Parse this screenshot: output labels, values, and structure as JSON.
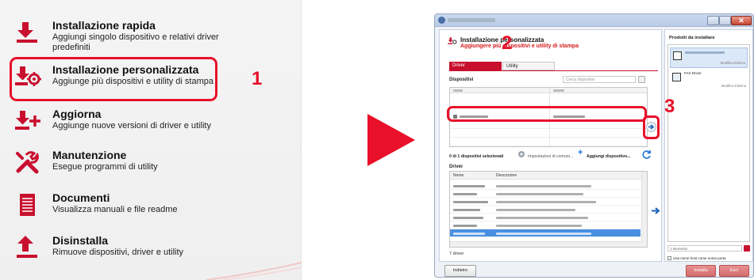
{
  "menu": {
    "items": [
      {
        "title": "Installazione rapida",
        "desc": "Aggiungi singolo dispositivo e relativi driver predefiniti",
        "icon": "download-icon"
      },
      {
        "title": "Installazione personalizzata",
        "desc": "Aggiunge più dispositivi e utility di stampa",
        "icon": "custom-install-icon"
      },
      {
        "title": "Aggiorna",
        "desc": "Aggiunge nuove versioni di driver e utility",
        "icon": "update-icon"
      },
      {
        "title": "Manutenzione",
        "desc": "Esegue programmi di utility",
        "icon": "tools-icon"
      },
      {
        "title": "Documenti",
        "desc": "Visualizza manuali e file readme",
        "icon": "document-icon"
      },
      {
        "title": "Disinstalla",
        "desc": "Rimuove dispositivi, driver e utility",
        "icon": "uninstall-icon"
      }
    ]
  },
  "callouts": {
    "one": "1",
    "two": "2",
    "three": "3"
  },
  "colors": {
    "accent": "#e8102a",
    "brand": "#c8102e",
    "selection": "#4a90e2"
  },
  "window": {
    "header_title": "Installazione personalizzata",
    "header_subtitle": "Aggiungere più dispositivi e utility di stampa",
    "tabs": [
      "Driver",
      "Utility"
    ],
    "devices_label": "Dispositivi",
    "search_placeholder": "Cerca dispositivi",
    "device_status": "0 di 1 dispositivi selezionati",
    "comm_settings_label": "Impostazioni di comuni...",
    "add_device_label": "Aggiungi dispositivo...",
    "driver_label": "Driver",
    "driver_columns": [
      "Nome",
      "Descrizione"
    ],
    "driver_count": "7 driver",
    "back_button": "Indietro",
    "install_button": "Installa",
    "exit_button": "Esci",
    "products_title": "Prodotti da installare",
    "product_actions": "Modifica  Elimina",
    "fax_driver_label": "FAX Driver",
    "element_count": "1 elemento",
    "hostname_option": "Usa nome host come nome porta"
  }
}
